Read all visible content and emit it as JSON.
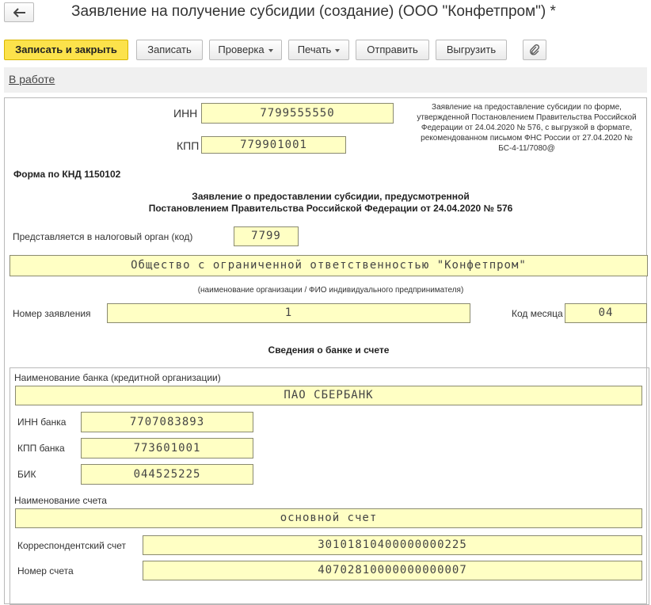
{
  "window": {
    "title": "Заявление на получение субсидии (создание) (ООО \"Конфетпром\") *"
  },
  "toolbar": {
    "save_close": "Записать и закрыть",
    "save": "Записать",
    "check": "Проверка",
    "print": "Печать",
    "send": "Отправить",
    "export": "Выгрузить"
  },
  "status": {
    "state": "В работе"
  },
  "form": {
    "inn_label": "ИНН",
    "inn": "7799555550",
    "kpp_label": "КПП",
    "kpp": "779901001",
    "note": "Заявление на предоставление субсидии по форме, утвержденной Постановлением Правительства Российской Федерации от 24.04.2020 № 576, с выгрузкой в формате, рекомендованном письмом ФНС России от 27.04.2020 № БС-4-11/7080@",
    "knd": "Форма по КНД 1150102",
    "heading_line1": "Заявление о предоставлении субсидии, предусмотренной",
    "heading_line2": "Постановлением Правительства Российской Федерации от 24.04.2020 № 576",
    "tax_office_label": "Представляется в налоговый орган (код)",
    "tax_office": "7799",
    "org_name": "Общество с ограниченной ответственностью \"Конфетпром\"",
    "org_name_caption": "(наименование организации / ФИО индивидуального предпринимателя)",
    "app_number_label": "Номер заявления",
    "app_number": "1",
    "month_code_label": "Код месяца",
    "month_code": "04",
    "bank_section_title": "Сведения о банке и счете"
  },
  "bank": {
    "name_label": "Наименование банка (кредитной организации)",
    "name": "ПАО СБЕРБАНК",
    "inn_label": "ИНН банка",
    "inn": "7707083893",
    "kpp_label": "КПП банка",
    "kpp": "773601001",
    "bik_label": "БИК",
    "bik": "044525225",
    "account_name_label": "Наименование счета",
    "account_name": "основной счет",
    "corr_account_label": "Корреспондентский счет",
    "corr_account": "30101810400000000225",
    "account_number_label": "Номер счета",
    "account_number": "40702810000000000007"
  }
}
